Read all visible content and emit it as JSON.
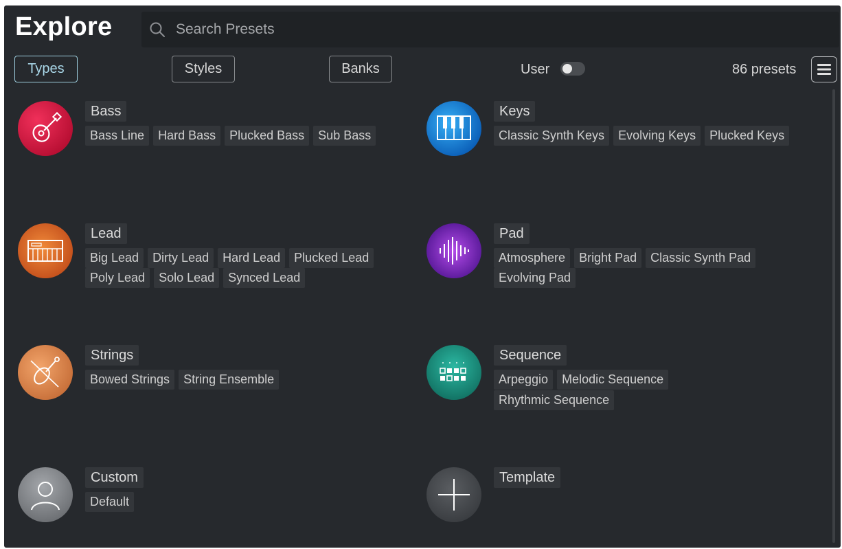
{
  "header": {
    "title": "Explore",
    "search_placeholder": "Search Presets"
  },
  "filters": {
    "types": "Types",
    "styles": "Styles",
    "banks": "Banks",
    "active": "Types"
  },
  "user_toggle": {
    "label": "User",
    "on": false
  },
  "preset_count": "86 presets",
  "categories": [
    {
      "name": "Bass",
      "icon": "guitar-icon",
      "tags": [
        "Bass Line",
        "Hard Bass",
        "Plucked Bass",
        "Sub Bass"
      ]
    },
    {
      "name": "Keys",
      "icon": "piano-keys-icon",
      "tags": [
        "Classic Synth Keys",
        "Evolving Keys",
        "Plucked Keys"
      ]
    },
    {
      "name": "Lead",
      "icon": "synth-keyboard-icon",
      "tags": [
        "Big Lead",
        "Dirty Lead",
        "Hard Lead",
        "Plucked Lead",
        "Poly Lead",
        "Solo Lead",
        "Synced Lead"
      ]
    },
    {
      "name": "Pad",
      "icon": "waveform-icon",
      "tags": [
        "Atmosphere",
        "Bright Pad",
        "Classic Synth Pad",
        "Evolving Pad"
      ]
    },
    {
      "name": "Strings",
      "icon": "violin-icon",
      "tags": [
        "Bowed Strings",
        "String Ensemble"
      ]
    },
    {
      "name": "Sequence",
      "icon": "step-sequencer-icon",
      "tags": [
        "Arpeggio",
        "Melodic Sequence",
        "Rhythmic Sequence"
      ]
    },
    {
      "name": "Custom",
      "icon": "user-icon",
      "tags": [
        "Default"
      ]
    },
    {
      "name": "Template",
      "icon": "plus-icon",
      "tags": []
    }
  ],
  "colors": {
    "background": "#26292d",
    "active_accent": "#9fd0e0",
    "bass": "#d6193f",
    "keys": "#1a8fe0",
    "lead": "#e0702a",
    "pad": "#8a2fd0",
    "strings": "#e08a4a",
    "sequence": "#1f9a8a",
    "custom": "#8a8d90",
    "template": "#4a4d51"
  }
}
